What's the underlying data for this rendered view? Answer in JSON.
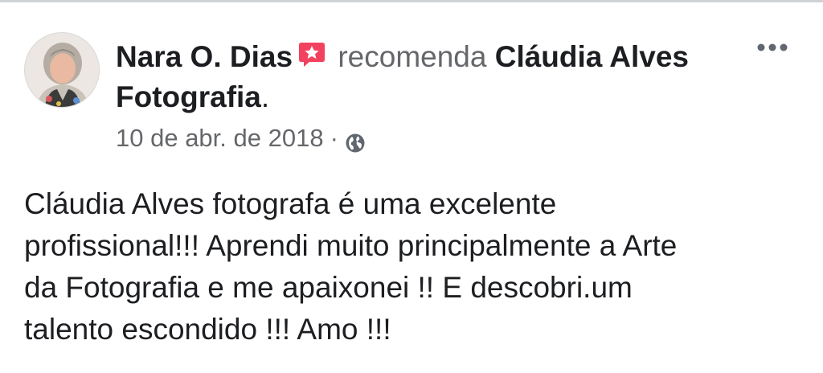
{
  "post": {
    "author": "Nara O. Dias",
    "verb": "recomenda",
    "page_name": "Cláudia Alves Fotografia",
    "period": ".",
    "date": "10 de abr. de 2018",
    "separator": "·",
    "privacy_icon": "globe-icon",
    "recommend_icon": "recommend-star-icon",
    "menu_icon": "more-options-icon",
    "text": "Cláudia Alves fotografa é uma excelente\nprofissional!!! Aprendi muito principalmente a Arte\nda Fotografia e me apaixonei !! E descobri.um\ntalento escondido !!! Amo !!!"
  },
  "colors": {
    "badge": "#f3425f",
    "secondary_text": "#65676b",
    "primary_text": "#1c1e21"
  }
}
